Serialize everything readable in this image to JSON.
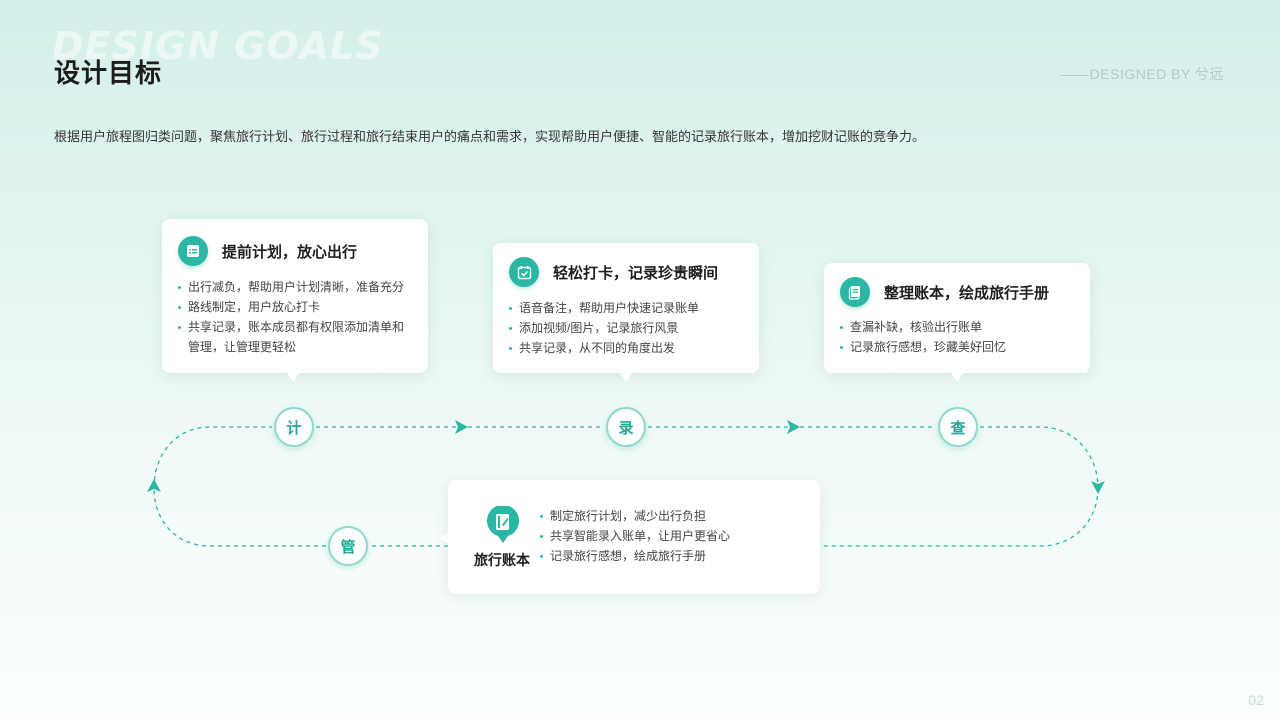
{
  "header": {
    "bg_title": "DESIGN GOALS",
    "title": "设计目标",
    "designed_by": "——DESIGNED BY  兮远"
  },
  "intro": "根据用户旅程图归类问题，聚焦旅行计划、旅行过程和旅行结束用户的痛点和需求，实现帮助用户便捷、智能的记录旅行账本，增加挖财记账的竞争力。",
  "cards": [
    {
      "title": "提前计划，放心出行",
      "icon": "list-icon",
      "items": [
        "出行减负，帮助用户计划清晰，准备充分",
        "路线制定，用户放心打卡",
        "共享记录，账本成员都有权限添加清单和",
        "管理，让管理更轻松"
      ]
    },
    {
      "title": "轻松打卡，记录珍贵瞬间",
      "icon": "calendar-check-icon",
      "items": [
        "语音备注，帮助用户快速记录账单",
        "添加视频/图片，记录旅行风景",
        "共享记录，从不同的角度出发"
      ]
    },
    {
      "title": "整理账本，绘成旅行手册",
      "icon": "document-icon",
      "items": [
        "查漏补缺，核验出行账单",
        "记录旅行感想，珍藏美好回忆"
      ]
    }
  ],
  "center_card": {
    "label": "旅行账本",
    "icon": "notebook-pin-icon",
    "items": [
      "制定旅行计划，减少出行负担",
      "共享智能录入账单，让用户更省心",
      "记录旅行感想，绘成旅行手册"
    ]
  },
  "nodes": [
    "计",
    "录",
    "查",
    "管"
  ],
  "page_number": "02",
  "colors": {
    "accent": "#2ab7a3",
    "node_border": "#8fd8cc",
    "background_top": "#d3efe9"
  }
}
